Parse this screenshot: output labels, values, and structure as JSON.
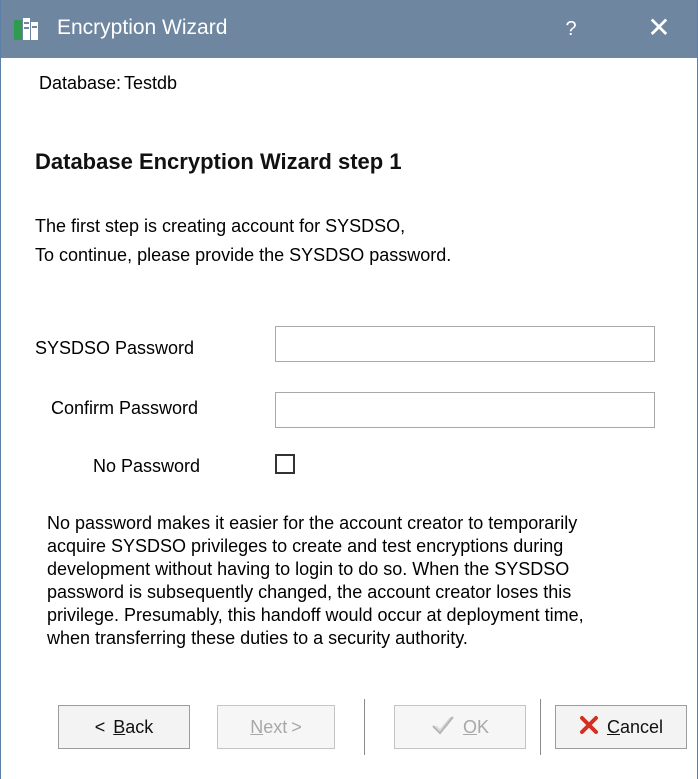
{
  "window": {
    "title": "Encryption Wizard",
    "help_label": "?",
    "close_label": "✕"
  },
  "database": {
    "label": "Database:",
    "name": "Testdb"
  },
  "step": {
    "heading": "Database Encryption Wizard step 1",
    "intro_line1": "The first step is creating account for SYSDSO,",
    "intro_line2": "To continue, please provide the SYSDSO password."
  },
  "form": {
    "sysdso_password_label": "SYSDSO Password",
    "sysdso_password_value": "",
    "confirm_password_label": "Confirm Password",
    "confirm_password_value": "",
    "no_password_label": "No Password",
    "no_password_checked": false
  },
  "note_lines": [
    "No password makes it easier for the account creator to temporarily",
    "acquire SYSDSO privileges to create and test encryptions during",
    "development without having to login to do so. When the SYSDSO",
    "password is subsequently changed, the account creator loses this",
    "privilege. Presumably, this handoff would occur at deployment time,",
    "when transferring these duties to a security authority."
  ],
  "buttons": {
    "back": {
      "arrow": "<",
      "mnemonic": "B",
      "rest": "ack",
      "enabled": true
    },
    "next": {
      "mnemonic": "N",
      "rest": "ext",
      "arrow": ">",
      "enabled": false
    },
    "ok": {
      "mnemonic": "O",
      "rest": "K",
      "enabled": false
    },
    "cancel": {
      "mnemonic": "C",
      "rest": "ancel",
      "enabled": true
    }
  },
  "colors": {
    "titlebar": "#6e86a0",
    "cancel_icon": "#d62e20"
  },
  "icons": {
    "app": "database-wizard-icon",
    "help": "help-icon",
    "close": "close-icon",
    "ok": "checkmark-icon",
    "cancel": "red-x-icon"
  }
}
